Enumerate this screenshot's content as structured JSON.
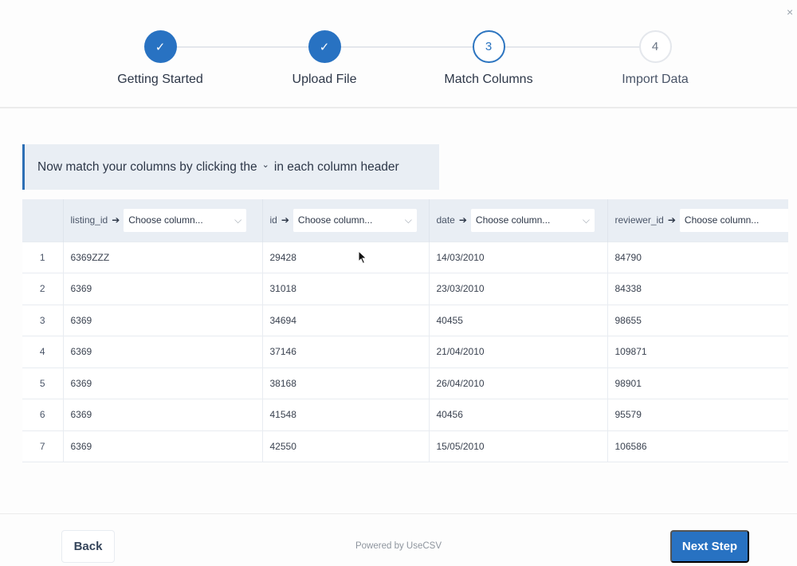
{
  "window": {
    "close_icon": "×"
  },
  "stepper": {
    "steps": [
      {
        "label": "Getting Started",
        "status": "done",
        "marker": "✓"
      },
      {
        "label": "Upload File",
        "status": "done",
        "marker": "✓"
      },
      {
        "label": "Match Columns",
        "status": "active",
        "marker": "3"
      },
      {
        "label": "Import Data",
        "status": "todo",
        "marker": "4"
      }
    ]
  },
  "banner": {
    "text_before": "Now match your columns by clicking the",
    "chevron": "⌄",
    "text_after": "in each column header"
  },
  "table": {
    "columns": [
      {
        "name": "listing_id",
        "select_placeholder": "Choose column..."
      },
      {
        "name": "id",
        "select_placeholder": "Choose column..."
      },
      {
        "name": "date",
        "select_placeholder": "Choose column..."
      },
      {
        "name": "reviewer_id",
        "select_placeholder": "Choose column..."
      }
    ],
    "arrow": "➔",
    "rows": [
      {
        "n": "1",
        "cells": [
          "6369ZZZ",
          "29428",
          "14/03/2010",
          "84790"
        ]
      },
      {
        "n": "2",
        "cells": [
          "6369",
          "31018",
          "23/03/2010",
          "84338"
        ]
      },
      {
        "n": "3",
        "cells": [
          "6369",
          "34694",
          "40455",
          "98655"
        ]
      },
      {
        "n": "4",
        "cells": [
          "6369",
          "37146",
          "21/04/2010",
          "109871"
        ]
      },
      {
        "n": "5",
        "cells": [
          "6369",
          "38168",
          "26/04/2010",
          "98901"
        ]
      },
      {
        "n": "6",
        "cells": [
          "6369",
          "41548",
          "40456",
          "95579"
        ]
      },
      {
        "n": "7",
        "cells": [
          "6369",
          "42550",
          "15/05/2010",
          "106586"
        ]
      }
    ]
  },
  "footer": {
    "back_label": "Back",
    "powered_by": "Powered by UseCSV",
    "next_label": "Next Step"
  },
  "colors": {
    "accent": "#2872c2",
    "banner_bg": "#e9eef4",
    "header_bg": "#e9eef4"
  }
}
